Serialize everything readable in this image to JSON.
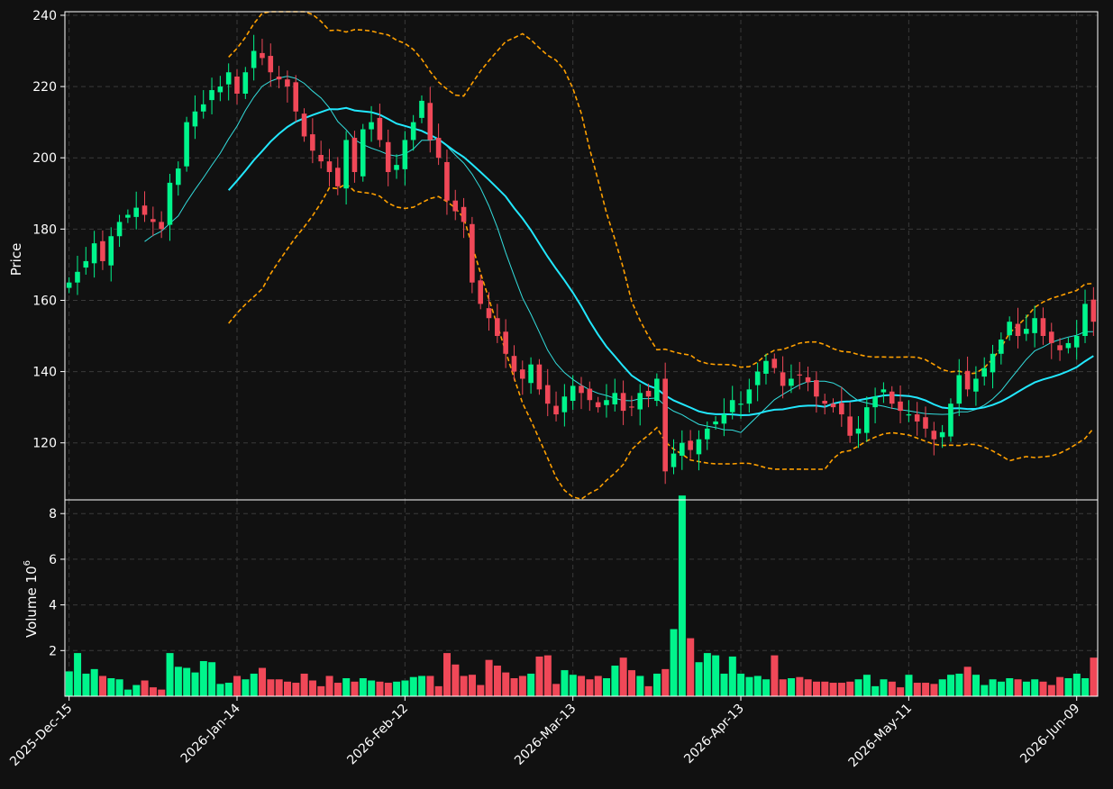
{
  "colors": {
    "background": "#111111",
    "up": "#00f58c",
    "down": "#f04858",
    "ma_fast": "#33dddd",
    "ma_slow": "#22e8ff",
    "bands": "#ffa000",
    "axis": "#ffffff",
    "grid": "#3a3a3a"
  },
  "chart_data": {
    "type": "candlestick",
    "ylabel_price": "Price",
    "ylabel_volume": "Volume",
    "volume_exponent": "10",
    "volume_exponent_power": "6",
    "price_ylim": [
      104,
      241
    ],
    "price_yticks": [
      "120",
      "140",
      "160",
      "180",
      "200",
      "220",
      "240"
    ],
    "volume_ylim": [
      0,
      8.6
    ],
    "volume_yticks": [
      "2",
      "4",
      "6",
      "8"
    ],
    "x_tick_labels": [
      {
        "index": 0,
        "label": "2025-Dec-15"
      },
      {
        "index": 20,
        "label": "2026-Jan-14"
      },
      {
        "index": 40,
        "label": "2026-Feb-12"
      },
      {
        "index": 60,
        "label": "2026-Mar-13"
      },
      {
        "index": 80,
        "label": "2026-Apr-13"
      },
      {
        "index": 100,
        "label": "2026-May-11"
      },
      {
        "index": 120,
        "label": "2026-Jun-09"
      }
    ],
    "grid": true,
    "close": [
      165,
      168,
      171,
      176,
      171,
      178,
      182,
      184,
      186,
      184,
      182,
      180,
      193,
      197,
      210,
      213,
      215,
      219,
      220,
      224,
      218,
      224,
      230,
      228,
      224,
      222,
      220,
      213,
      206,
      202,
      199,
      196,
      192,
      205,
      196,
      208,
      210,
      205,
      196,
      198,
      205,
      210,
      216,
      205,
      200,
      188,
      185,
      182,
      165,
      159,
      155,
      150,
      145,
      140,
      138,
      142,
      135,
      131,
      128,
      133,
      136,
      134,
      132,
      130,
      132,
      134,
      129,
      130,
      134,
      133,
      138,
      112,
      117,
      120,
      118,
      121,
      124,
      126,
      128,
      132,
      131,
      135,
      140,
      143,
      141,
      136,
      138,
      139,
      137,
      133,
      131,
      130,
      128,
      122,
      124,
      130,
      133,
      135,
      131,
      129,
      128,
      126,
      124,
      121,
      123,
      131,
      139,
      135,
      138,
      141,
      145,
      149,
      154,
      150,
      152,
      155,
      150,
      148,
      146,
      148,
      150,
      159,
      154
    ],
    "volume": [
      1.1,
      1.9,
      1.0,
      1.2,
      0.9,
      0.8,
      0.75,
      0.3,
      0.5,
      0.7,
      0.4,
      0.3,
      1.9,
      1.3,
      1.25,
      1.05,
      1.55,
      1.5,
      0.55,
      0.6,
      0.9,
      0.75,
      1.0,
      1.25,
      0.75,
      0.75,
      0.65,
      0.6,
      1.0,
      0.7,
      0.45,
      0.9,
      0.6,
      0.8,
      0.65,
      0.8,
      0.7,
      0.65,
      0.6,
      0.65,
      0.7,
      0.85,
      0.9,
      0.9,
      0.45,
      1.9,
      1.4,
      0.9,
      0.95,
      0.5,
      1.6,
      1.35,
      1.05,
      0.8,
      0.9,
      1.0,
      1.75,
      1.8,
      0.55,
      1.15,
      0.95,
      0.9,
      0.75,
      0.9,
      0.8,
      1.35,
      1.7,
      1.15,
      0.9,
      0.45,
      1.0,
      1.2,
      2.95,
      8.8,
      2.55,
      1.5,
      1.9,
      1.8,
      1.0,
      1.75,
      1.0,
      0.85,
      0.9,
      0.75,
      1.8,
      0.75,
      0.8,
      0.85,
      0.75,
      0.65,
      0.65,
      0.6,
      0.6,
      0.65,
      0.75,
      0.95,
      0.45,
      0.75,
      0.65,
      0.4,
      0.95,
      0.6,
      0.6,
      0.55,
      0.75,
      0.95,
      1.0,
      1.3,
      0.95,
      0.5,
      0.75,
      0.65,
      0.8,
      0.75,
      0.65,
      0.75,
      0.65,
      0.5,
      0.85,
      0.8,
      1.0,
      0.8,
      1.7,
      1.9
    ]
  }
}
